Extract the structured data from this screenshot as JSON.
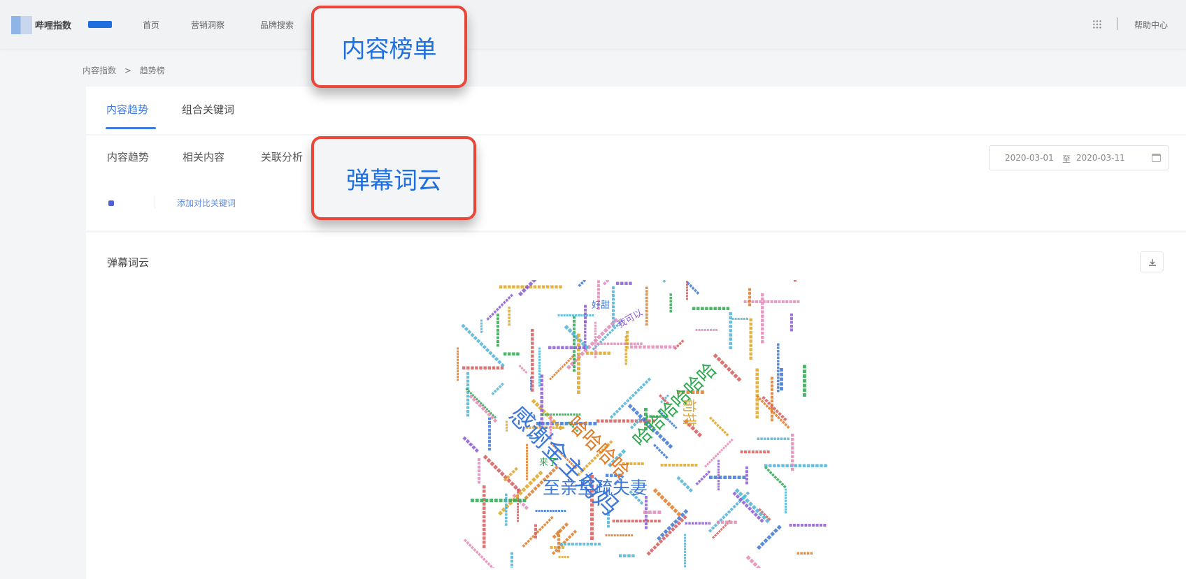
{
  "header": {
    "logo_text": "哔哩指数",
    "nav": [
      "首页",
      "营销洞察",
      "品牌搜索"
    ],
    "help": "帮助中心"
  },
  "breadcrumb": [
    "内容指数",
    ">",
    "趋势榜"
  ],
  "main_tabs": [
    {
      "label": "内容趋势",
      "active": true
    },
    {
      "label": "组合关键词",
      "active": false
    }
  ],
  "sub_tabs": [
    "内容趋势",
    "相关内容",
    "关联分析"
  ],
  "date_range": {
    "start": "2020-03-01",
    "sep": "至",
    "end": "2020-03-11"
  },
  "add_keyword": "添加对比关键词",
  "cloud": {
    "title": "弹幕词云",
    "words": [
      {
        "text": "感谢金主妈妈",
        "color": "#3d78d8"
      },
      {
        "text": "哈哈哈哈哈哈",
        "color": "#2fa84f"
      },
      {
        "text": "哈哈哈哈",
        "color": "#e07b28"
      },
      {
        "text": "至亲至疏夫妻",
        "color": "#3d78d8"
      },
      {
        "text": "前排",
        "color": "#e0a528"
      },
      {
        "text": "好甜",
        "color": "#3d78d8"
      },
      {
        "text": "我可以",
        "color": "#8b5bd6"
      },
      {
        "text": "来了",
        "color": "#2fa84f"
      }
    ]
  },
  "callouts": {
    "one": "内容榜单",
    "two": "弹幕词云"
  },
  "colors": {
    "accent": "#3d7be0",
    "callout_border": "#e8473a",
    "callout_text": "#1e6fe0"
  }
}
